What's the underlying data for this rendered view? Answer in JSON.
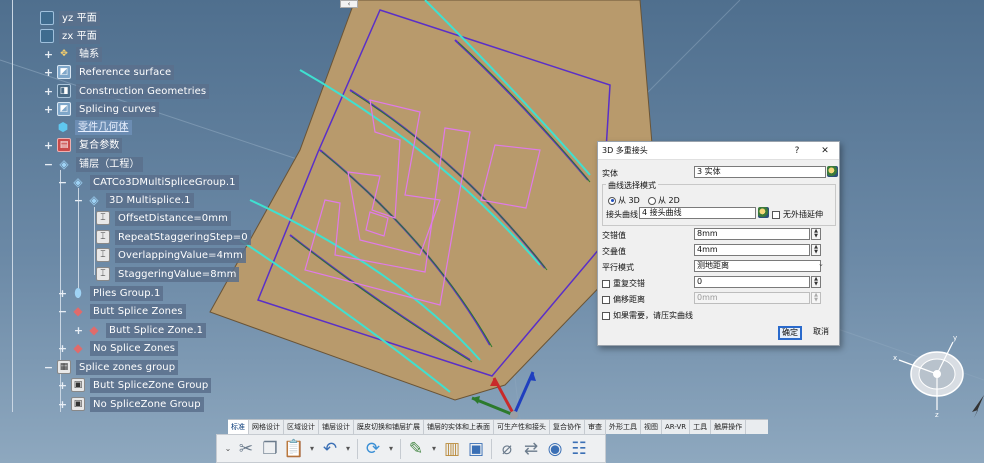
{
  "tree": {
    "items": [
      {
        "label": "yz 平面"
      },
      {
        "label": "zx 平面"
      },
      {
        "label": "轴系"
      },
      {
        "label": "Reference surface"
      },
      {
        "label": "Construction Geometries"
      },
      {
        "label": "Splicing curves"
      },
      {
        "label": "零件几何体"
      },
      {
        "label": "复合参数"
      },
      {
        "label": "铺层（工程）"
      },
      {
        "label": "CATCo3DMultiSpliceGroup.1"
      },
      {
        "label": "3D Multisplice.1"
      },
      {
        "label": "OffsetDistance=0mm"
      },
      {
        "label": "RepeatStaggeringStep=0"
      },
      {
        "label": "OverlappingValue=4mm"
      },
      {
        "label": "StaggeringValue=8mm"
      },
      {
        "label": "Plies Group.1"
      },
      {
        "label": "Butt Splice Zones"
      },
      {
        "label": "Butt Splice Zone.1"
      },
      {
        "label": "No Splice Zones"
      },
      {
        "label": "Splice zones group"
      },
      {
        "label": "Butt SpliceZone Group"
      },
      {
        "label": "No SpliceZone Group"
      }
    ]
  },
  "collapse_tab": "‹",
  "dialog": {
    "title": "3D 多重接头",
    "help": "?",
    "close": "✕",
    "entity_label": "实体",
    "entity_value": "3 实体",
    "curve_mode_group": "曲线选择模式",
    "from_3d": "从 3D",
    "from_2d": "从 2D",
    "splice_curve_label": "接头曲线",
    "splice_curve_value": "4 接头曲线",
    "no_extrapolate": "无外插延伸",
    "staggering_label": "交错值",
    "staggering_value": "8mm",
    "overlap_label": "交叠值",
    "overlap_value": "4mm",
    "parallel_label": "平行模式",
    "parallel_value": "测地距离",
    "repeat_label": "重复交错",
    "repeat_value": "0",
    "offset_label": "偏移距离",
    "offset_value": "0mm",
    "compress_label": "如果需要，请压实曲线",
    "ok": "确定",
    "cancel": "取消"
  },
  "toolbar": {
    "tabs": [
      "标准",
      "网格设计",
      "区域设计",
      "铺层设计",
      "膜皮切换和铺层扩展",
      "铺层的实体和上表面",
      "可生产性和接头",
      "复合协作",
      "审查",
      "外形工具",
      "视图",
      "AR-VR",
      "工具",
      "触屏操作"
    ],
    "active_tab": "标准"
  },
  "colors": {
    "background": "#5a7a98",
    "surface": "#b89a6c",
    "splice_purple": "#5a2fc8",
    "splice_cyan": "#3fe0d0",
    "green": "#2c7a2c",
    "zone_pink": "#e07ae8"
  },
  "icons": [
    "plane-icon",
    "axis-icon",
    "surface-icon",
    "geometry-icon",
    "curves-icon",
    "body-icon",
    "parameters-icon",
    "plies-icon",
    "splice-group-icon",
    "parameter-icon",
    "zone-icon",
    "cut-icon",
    "copy-icon",
    "paste-icon",
    "undo-icon",
    "update-icon",
    "measure-icon",
    "compass-icon"
  ]
}
